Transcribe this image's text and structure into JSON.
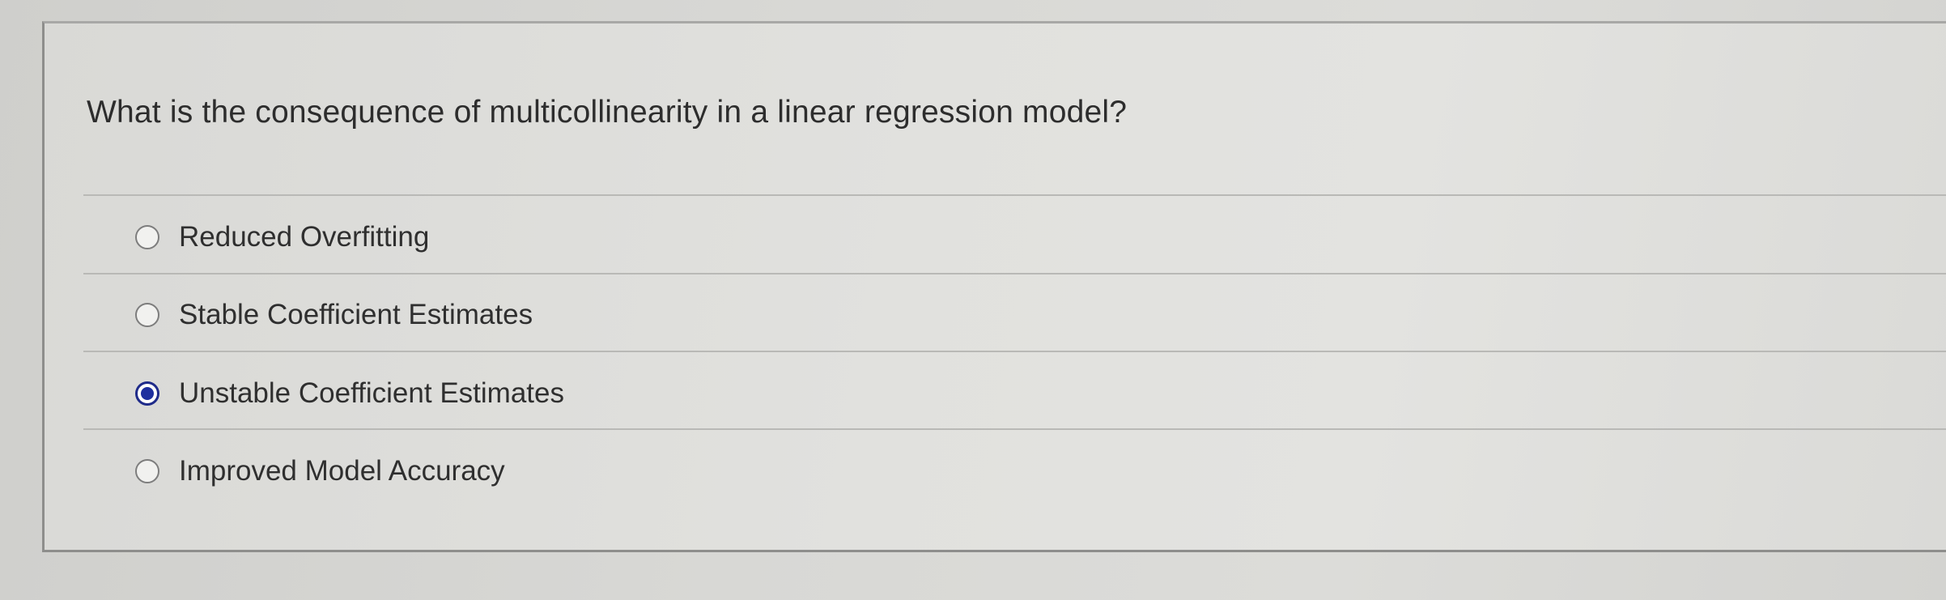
{
  "question": {
    "text": "What is the consequence of multicollinearity in a linear regression model?"
  },
  "answers": [
    {
      "label": "Reduced Overfitting",
      "selected": false
    },
    {
      "label": "Stable Coefficient Estimates",
      "selected": false
    },
    {
      "label": "Unstable Coefficient Estimates",
      "selected": true
    },
    {
      "label": "Improved Model Accuracy",
      "selected": false
    }
  ],
  "colors": {
    "selected_radio": "#1e2f9e",
    "text": "#2f2f2f",
    "background": "#dcdcd9"
  }
}
